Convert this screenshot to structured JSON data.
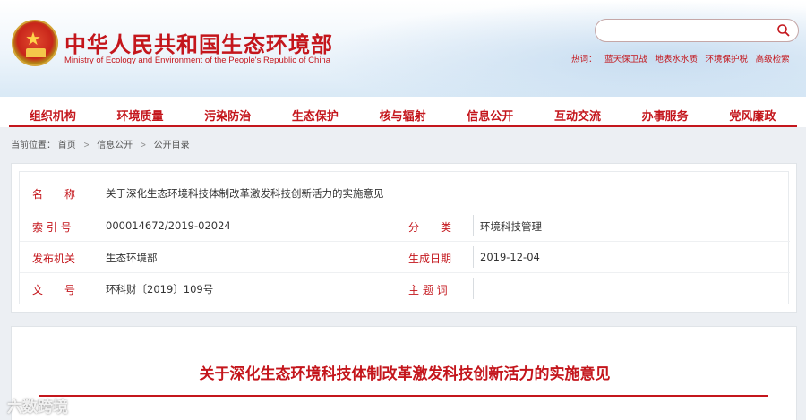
{
  "header": {
    "title": "中华人民共和国生态环境部",
    "subtitle": "Ministry of Ecology and Environment of the People's Republic of China",
    "search_placeholder": "",
    "hot_label": "热词：",
    "hot_words": [
      "蓝天保卫战",
      "地表水水质",
      "环境保护税"
    ],
    "advanced_search": "高级检索"
  },
  "nav": {
    "items": [
      "组织机构",
      "环境质量",
      "污染防治",
      "生态保护",
      "核与辐射",
      "信息公开",
      "互动交流",
      "办事服务",
      "党风廉政"
    ]
  },
  "breadcrumb": {
    "prefix": "当前位置：",
    "items": [
      "首页",
      "信息公开",
      "公开目录"
    ],
    "separator": ">"
  },
  "info": {
    "name_label": "名　　称",
    "name_value": "关于深化生态环境科技体制改革激发科技创新活力的实施意见",
    "index_label": "索 引 号",
    "index_value": "000014672/2019-02024",
    "category_label": "分　　类",
    "category_value": "环境科技管理",
    "issuer_label": "发布机关",
    "issuer_value": "生态环境部",
    "date_label": "生成日期",
    "date_value": "2019-12-04",
    "docno_label": "文　　号",
    "docno_value": "环科财〔2019〕109号",
    "topic_label": "主 题 词",
    "topic_value": ""
  },
  "article": {
    "title": "关于深化生态环境科技体制改革激发科技创新活力的实施意见"
  },
  "watermark": "六数跨境",
  "colors": {
    "brand_red": "#c4161c",
    "page_bg": "#eceff3"
  }
}
